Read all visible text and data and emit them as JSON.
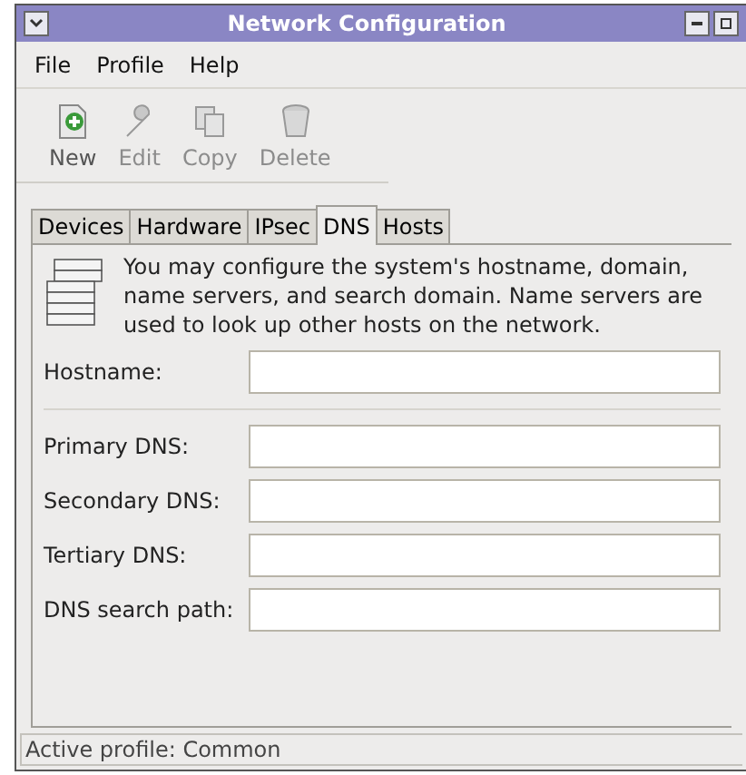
{
  "window": {
    "title": "Network Configuration"
  },
  "menu": [
    "File",
    "Profile",
    "Help"
  ],
  "toolbar": [
    {
      "label": "New",
      "disabled": false
    },
    {
      "label": "Edit",
      "disabled": true
    },
    {
      "label": "Copy",
      "disabled": true
    },
    {
      "label": "Delete",
      "disabled": true
    }
  ],
  "tabs": [
    {
      "label": "Devices",
      "selected": false
    },
    {
      "label": "Hardware",
      "selected": false
    },
    {
      "label": "IPsec",
      "selected": false
    },
    {
      "label": "DNS",
      "selected": true
    },
    {
      "label": "Hosts",
      "selected": false
    }
  ],
  "description": "You may configure the system's hostname, domain, name servers, and search domain. Name servers are used to look up other hosts on the network.",
  "hostname": {
    "label": "Hostname:"
  },
  "dns_fields": [
    {
      "label": "Primary DNS:"
    },
    {
      "label": "Secondary DNS:"
    },
    {
      "label": "Tertiary DNS:"
    },
    {
      "label": "DNS search path:"
    }
  ],
  "status_bar": "Active profile: Common"
}
